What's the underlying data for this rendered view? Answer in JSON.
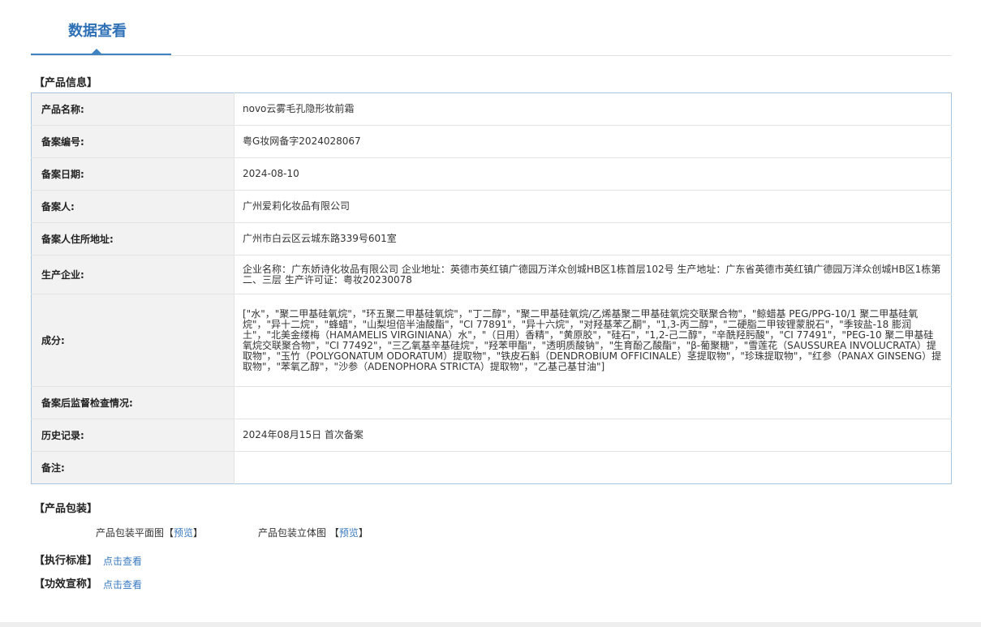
{
  "tab": {
    "title": "数据查看"
  },
  "sections": {
    "product_info": "【产品信息】",
    "packaging": "【产品包装】",
    "standard": "【执行标准】",
    "efficacy": "【功效宣称】"
  },
  "product_info": {
    "rows": [
      {
        "label": "产品名称:",
        "value": "novo云雾毛孔隐形妆前霜"
      },
      {
        "label": "备案编号:",
        "value": "粤G妆网备字2024028067"
      },
      {
        "label": "备案日期:",
        "value": "2024-08-10"
      },
      {
        "label": "备案人:",
        "value": "广州爱莉化妆品有限公司"
      },
      {
        "label": "备案人住所地址:",
        "value": "广州市白云区云城东路339号601室"
      },
      {
        "label": "生产企业:",
        "value": "企业名称：广东娇诗化妆品有限公司 企业地址：英德市英红镇广德园万洋众创城HB区1栋首层102号 生产地址：广东省英德市英红镇广德园万洋众创城HB区1栋第二、三层 生产许可证：粤妆20230078"
      },
      {
        "label": "成分:",
        "value": "[\"水\"，\"聚二甲基硅氧烷\"，\"环五聚二甲基硅氧烷\"，\"丁二醇\"，\"聚二甲基硅氧烷/乙烯基聚二甲基硅氧烷交联聚合物\"，\"鲸蜡基 PEG/PPG-10/1 聚二甲基硅氧烷\"，\"异十二烷\"，\"蜂蜡\"，\"山梨坦倍半油酸酯\"，\"CI 77891\"，\"异十六烷\"，\"对羟基苯乙酮\"，\"1,3-丙二醇\"，\"二硬脂二甲铵锂蒙脱石\"，\"季铵盐-18 膨润土\"，\"北美金缕梅（HAMAMELIS VIRGINIANA）水\"，\"（日用）香精\"，\"黄原胶\"，\"硅石\"，\"1,2-己二醇\"，\"辛酰羟肟酸\"，\"CI 77491\"，\"PEG-10 聚二甲基硅氧烷交联聚合物\"，\"CI 77492\"，\"三乙氧基辛基硅烷\"，\"羟苯甲酯\"，\"透明质酸钠\"，\"生育酚乙酸酯\"，\"β-葡聚糖\"，\"雪莲花（SAUSSUREA INVOLUCRATA）提取物\"，\"玉竹（POLYGONATUM ODORATUM）提取物\"，\"铁皮石斛（DENDROBIUM OFFICINALE）茎提取物\"，\"珍珠提取物\"，\"红参（PANAX GINSENG）提取物\"，\"苯氧乙醇\"，\"沙参（ADENOPHORA STRICTA）提取物\"，\"乙基己基甘油\"]"
      },
      {
        "label": "备案后监督检查情况:",
        "value": ""
      },
      {
        "label": "历史记录:",
        "value": "2024年08月15日 首次备案"
      },
      {
        "label": "备注:",
        "value": ""
      }
    ]
  },
  "packaging": {
    "flat_label": "产品包装平面图",
    "solid_label": "产品包装立体图",
    "bracket_open": "【",
    "bracket_close": "】",
    "preview": "预览"
  },
  "standard": {
    "link": "点击查看"
  },
  "efficacy": {
    "link": "点击查看"
  }
}
